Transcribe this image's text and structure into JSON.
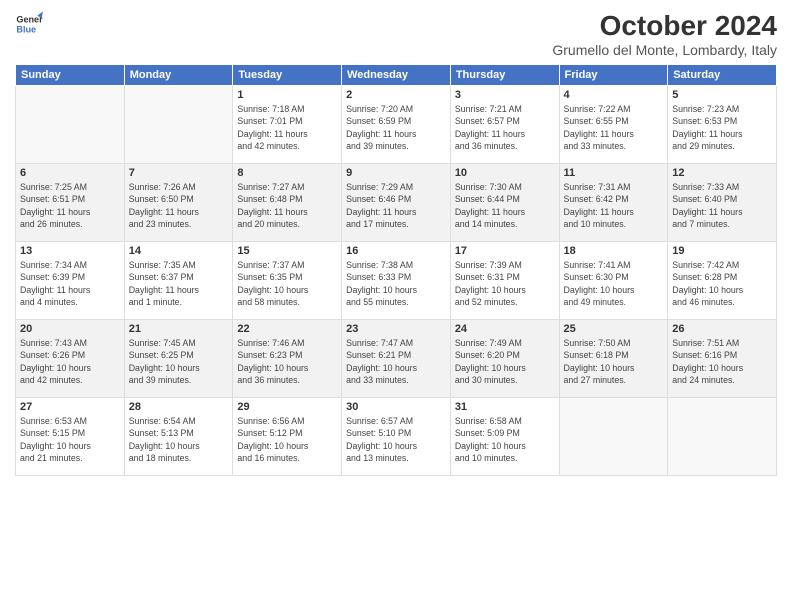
{
  "header": {
    "logo_line1": "General",
    "logo_line2": "Blue",
    "month": "October 2024",
    "location": "Grumello del Monte, Lombardy, Italy"
  },
  "days_of_week": [
    "Sunday",
    "Monday",
    "Tuesday",
    "Wednesday",
    "Thursday",
    "Friday",
    "Saturday"
  ],
  "weeks": [
    [
      {
        "day": "",
        "info": ""
      },
      {
        "day": "",
        "info": ""
      },
      {
        "day": "1",
        "info": "Sunrise: 7:18 AM\nSunset: 7:01 PM\nDaylight: 11 hours\nand 42 minutes."
      },
      {
        "day": "2",
        "info": "Sunrise: 7:20 AM\nSunset: 6:59 PM\nDaylight: 11 hours\nand 39 minutes."
      },
      {
        "day": "3",
        "info": "Sunrise: 7:21 AM\nSunset: 6:57 PM\nDaylight: 11 hours\nand 36 minutes."
      },
      {
        "day": "4",
        "info": "Sunrise: 7:22 AM\nSunset: 6:55 PM\nDaylight: 11 hours\nand 33 minutes."
      },
      {
        "day": "5",
        "info": "Sunrise: 7:23 AM\nSunset: 6:53 PM\nDaylight: 11 hours\nand 29 minutes."
      }
    ],
    [
      {
        "day": "6",
        "info": "Sunrise: 7:25 AM\nSunset: 6:51 PM\nDaylight: 11 hours\nand 26 minutes."
      },
      {
        "day": "7",
        "info": "Sunrise: 7:26 AM\nSunset: 6:50 PM\nDaylight: 11 hours\nand 23 minutes."
      },
      {
        "day": "8",
        "info": "Sunrise: 7:27 AM\nSunset: 6:48 PM\nDaylight: 11 hours\nand 20 minutes."
      },
      {
        "day": "9",
        "info": "Sunrise: 7:29 AM\nSunset: 6:46 PM\nDaylight: 11 hours\nand 17 minutes."
      },
      {
        "day": "10",
        "info": "Sunrise: 7:30 AM\nSunset: 6:44 PM\nDaylight: 11 hours\nand 14 minutes."
      },
      {
        "day": "11",
        "info": "Sunrise: 7:31 AM\nSunset: 6:42 PM\nDaylight: 11 hours\nand 10 minutes."
      },
      {
        "day": "12",
        "info": "Sunrise: 7:33 AM\nSunset: 6:40 PM\nDaylight: 11 hours\nand 7 minutes."
      }
    ],
    [
      {
        "day": "13",
        "info": "Sunrise: 7:34 AM\nSunset: 6:39 PM\nDaylight: 11 hours\nand 4 minutes."
      },
      {
        "day": "14",
        "info": "Sunrise: 7:35 AM\nSunset: 6:37 PM\nDaylight: 11 hours\nand 1 minute."
      },
      {
        "day": "15",
        "info": "Sunrise: 7:37 AM\nSunset: 6:35 PM\nDaylight: 10 hours\nand 58 minutes."
      },
      {
        "day": "16",
        "info": "Sunrise: 7:38 AM\nSunset: 6:33 PM\nDaylight: 10 hours\nand 55 minutes."
      },
      {
        "day": "17",
        "info": "Sunrise: 7:39 AM\nSunset: 6:31 PM\nDaylight: 10 hours\nand 52 minutes."
      },
      {
        "day": "18",
        "info": "Sunrise: 7:41 AM\nSunset: 6:30 PM\nDaylight: 10 hours\nand 49 minutes."
      },
      {
        "day": "19",
        "info": "Sunrise: 7:42 AM\nSunset: 6:28 PM\nDaylight: 10 hours\nand 46 minutes."
      }
    ],
    [
      {
        "day": "20",
        "info": "Sunrise: 7:43 AM\nSunset: 6:26 PM\nDaylight: 10 hours\nand 42 minutes."
      },
      {
        "day": "21",
        "info": "Sunrise: 7:45 AM\nSunset: 6:25 PM\nDaylight: 10 hours\nand 39 minutes."
      },
      {
        "day": "22",
        "info": "Sunrise: 7:46 AM\nSunset: 6:23 PM\nDaylight: 10 hours\nand 36 minutes."
      },
      {
        "day": "23",
        "info": "Sunrise: 7:47 AM\nSunset: 6:21 PM\nDaylight: 10 hours\nand 33 minutes."
      },
      {
        "day": "24",
        "info": "Sunrise: 7:49 AM\nSunset: 6:20 PM\nDaylight: 10 hours\nand 30 minutes."
      },
      {
        "day": "25",
        "info": "Sunrise: 7:50 AM\nSunset: 6:18 PM\nDaylight: 10 hours\nand 27 minutes."
      },
      {
        "day": "26",
        "info": "Sunrise: 7:51 AM\nSunset: 6:16 PM\nDaylight: 10 hours\nand 24 minutes."
      }
    ],
    [
      {
        "day": "27",
        "info": "Sunrise: 6:53 AM\nSunset: 5:15 PM\nDaylight: 10 hours\nand 21 minutes."
      },
      {
        "day": "28",
        "info": "Sunrise: 6:54 AM\nSunset: 5:13 PM\nDaylight: 10 hours\nand 18 minutes."
      },
      {
        "day": "29",
        "info": "Sunrise: 6:56 AM\nSunset: 5:12 PM\nDaylight: 10 hours\nand 16 minutes."
      },
      {
        "day": "30",
        "info": "Sunrise: 6:57 AM\nSunset: 5:10 PM\nDaylight: 10 hours\nand 13 minutes."
      },
      {
        "day": "31",
        "info": "Sunrise: 6:58 AM\nSunset: 5:09 PM\nDaylight: 10 hours\nand 10 minutes."
      },
      {
        "day": "",
        "info": ""
      },
      {
        "day": "",
        "info": ""
      }
    ]
  ]
}
